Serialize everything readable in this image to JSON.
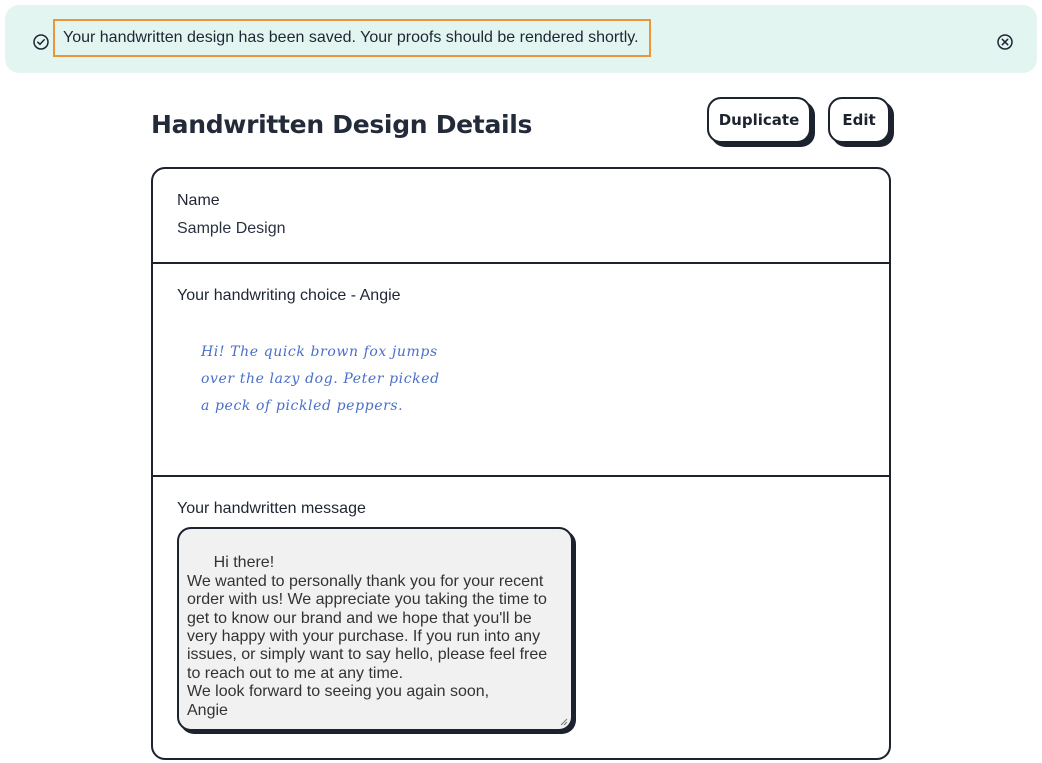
{
  "banner": {
    "message": "Your handwritten design has been saved. Your proofs should be rendered shortly.",
    "status_icon": "check-circle-icon",
    "close_icon": "close-circle-icon"
  },
  "page": {
    "title": "Handwritten Design Details"
  },
  "actions": {
    "duplicate_label": "Duplicate",
    "edit_label": "Edit"
  },
  "details": {
    "name_label": "Name",
    "name_value": "Sample Design",
    "handwriting_label": "Your handwriting choice - Angie",
    "handwriting_sample": [
      "Hi! The quick brown fox jumps",
      "over the lazy dog. Peter picked",
      "a peck of pickled peppers."
    ],
    "message_label": "Your handwritten message",
    "message_text": "Hi there!\nWe wanted to personally thank you for your recent order with us! We appreciate you taking the time to get to know our brand and we hope that you'll be very happy with your purchase. If you run into any issues, or simply want to say hello, please feel free to reach out to me at any time.\nWe look forward to seeing you again soon,\nAngie"
  },
  "colors": {
    "banner_bg": "#e3f5f1",
    "highlight_border": "#e8973a",
    "handwriting_ink": "#4a6fc9",
    "border_dark": "#1c222e"
  }
}
